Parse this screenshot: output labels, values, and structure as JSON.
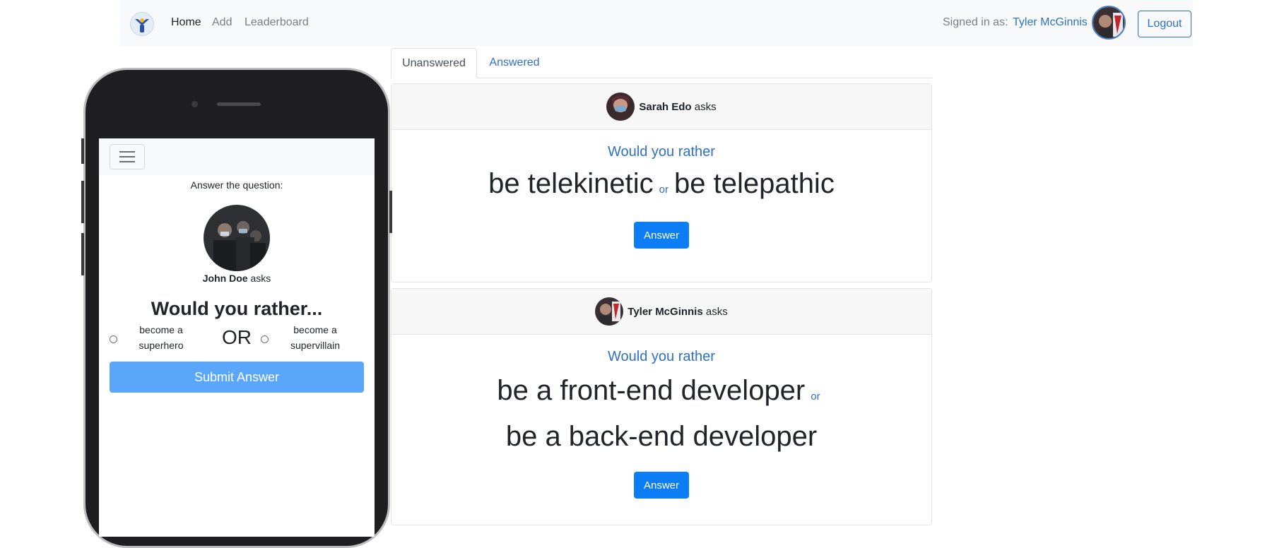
{
  "navbar": {
    "links": [
      "Home",
      "Add",
      "Leaderboard"
    ],
    "signed_in_label": "Signed in as:",
    "user_name": "Tyler McGinnis",
    "logout_label": "Logout"
  },
  "tabs": [
    "Unanswered",
    "Answered"
  ],
  "questions": [
    {
      "author": "Sarah Edo",
      "asks": "asks",
      "title": "Would you rather",
      "option_one": "be telekinetic",
      "or": "or",
      "option_two": "be telepathic",
      "button": "Answer"
    },
    {
      "author": "Tyler McGinnis",
      "asks": "asks",
      "title": "Would you rather",
      "option_one": "be a front-end developer",
      "or": "or",
      "option_two": "be a back-end developer",
      "button": "Answer"
    }
  ],
  "mobile": {
    "prompt": "Answer the question:",
    "author": "John Doe",
    "asks": "asks",
    "title": "Would you rather...",
    "option_one": "become a superhero",
    "or": "OR",
    "option_two": "become a supervillain",
    "submit": "Submit Answer"
  },
  "colors": {
    "link": "#2f70c4",
    "primary_button": "#0d7df5",
    "submit_button": "#5aa6fa",
    "navbar_bg": "#f8f9fa",
    "phone_body": "#1f1f21"
  },
  "icons": [
    "app-logo-icon",
    "hamburger-menu-icon",
    "user-avatar"
  ]
}
